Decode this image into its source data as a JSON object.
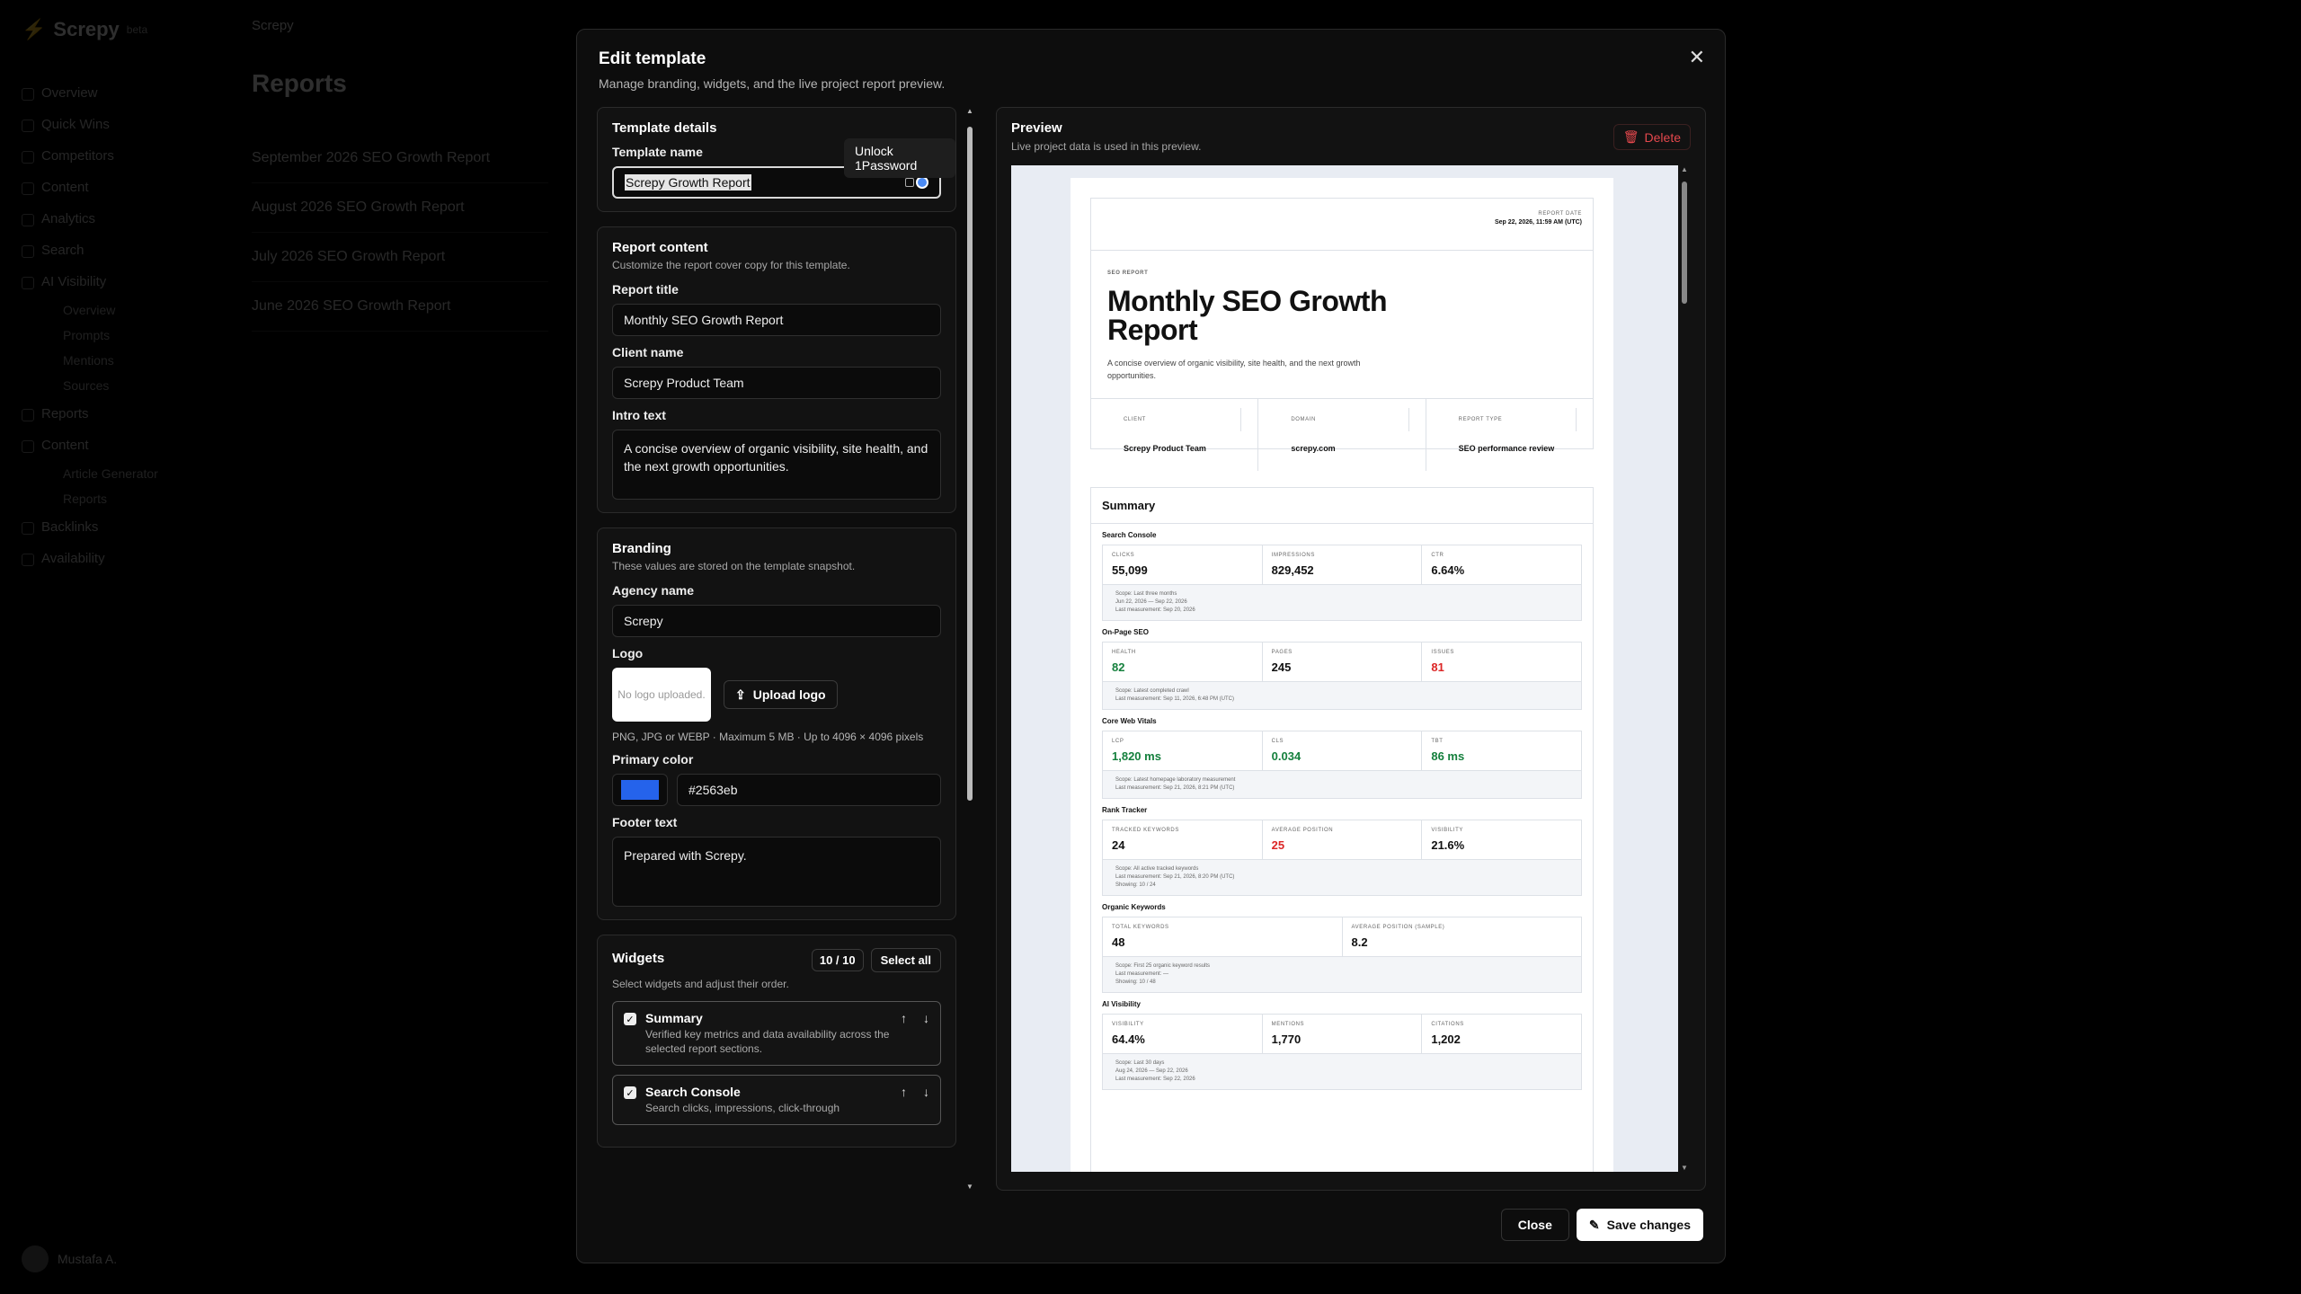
{
  "background": {
    "brand": "Screpy",
    "brand_badge": "beta",
    "workspace": "Screpy",
    "nav": [
      "Overview",
      "Quick Wins",
      "Competitors",
      "Content",
      "Analytics",
      "Search",
      "AI Visibility"
    ],
    "nav_sub": [
      "Overview",
      "Prompts",
      "Mentions",
      "Sources"
    ],
    "nav2": [
      "Reports",
      "Content"
    ],
    "nav2_sub": [
      "Article Generator",
      "Reports"
    ],
    "nav3": [
      "Backlinks",
      "Availability"
    ],
    "page_title": "Reports",
    "rows": [
      "September 2026 SEO Growth Report",
      "August 2026 SEO Growth Report",
      "July 2026 SEO Growth Report",
      "June 2026 SEO Growth Report"
    ],
    "user": "Mustafa A."
  },
  "modal": {
    "title": "Edit template",
    "subtitle": "Manage branding, widgets, and the live project report preview.",
    "template_details": {
      "title": "Template details",
      "name_label": "Template name",
      "name_value": "Screpy Growth Report",
      "tooltip": "Unlock 1Password"
    },
    "report_content": {
      "title": "Report content",
      "desc": "Customize the report cover copy for this template.",
      "report_title_label": "Report title",
      "report_title_value": "Monthly SEO Growth Report",
      "client_label": "Client name",
      "client_value": "Screpy Product Team",
      "intro_label": "Intro text",
      "intro_value": "A concise overview of organic visibility, site health, and the next growth opportunities."
    },
    "branding": {
      "title": "Branding",
      "desc": "These values are stored on the template snapshot.",
      "agency_label": "Agency name",
      "agency_value": "Screpy",
      "logo_label": "Logo",
      "logo_placeholder": "No logo uploaded.",
      "upload_label": "Upload logo",
      "logo_hint": "PNG, JPG or WEBP · Maximum 5 MB · Up to 4096 × 4096 pixels",
      "color_label": "Primary color",
      "color_value": "#2563eb",
      "footer_label": "Footer text",
      "footer_value": "Prepared with Screpy."
    },
    "widgets": {
      "title": "Widgets",
      "count": "10 / 10",
      "select_all": "Select all",
      "desc": "Select widgets and adjust their order.",
      "items": [
        {
          "name": "Summary",
          "desc": "Verified key metrics and data availability across the selected report sections."
        },
        {
          "name": "Search Console",
          "desc": "Search clicks, impressions, click-through"
        }
      ]
    },
    "preview": {
      "title": "Preview",
      "subtitle": "Live project data is used in this preview.",
      "delete_label": "Delete"
    },
    "close_label": "Close",
    "save_label": "Save changes"
  },
  "report": {
    "date_label": "REPORT DATE",
    "date_value": "Sep 22, 2026, 11:59 AM (UTC)",
    "eyebrow": "SEO REPORT",
    "title_line1": "Monthly SEO Growth",
    "title_line2": "Report",
    "intro_line1": "A concise overview of organic visibility, site health, and the next growth",
    "intro_line2": "opportunities.",
    "meta": [
      {
        "label": "CLIENT",
        "value": "Screpy Product Team"
      },
      {
        "label": "DOMAIN",
        "value": "screpy.com"
      },
      {
        "label": "REPORT TYPE",
        "value": "SEO performance review"
      }
    ],
    "summary_title": "Summary",
    "sections": [
      {
        "name": "Search Console",
        "metrics": [
          {
            "label": "CLICKS",
            "value": "55,099"
          },
          {
            "label": "IMPRESSIONS",
            "value": "829,452"
          },
          {
            "label": "CTR",
            "value": "6.64%"
          }
        ],
        "scope": [
          "Scope: Last three months",
          "Jun 22, 2026 — Sep 22, 2026",
          "Last measurement: Sep 20, 2026"
        ]
      },
      {
        "name": "On-Page SEO",
        "metrics": [
          {
            "label": "HEALTH",
            "value": "82"
          },
          {
            "label": "PAGES",
            "value": "245"
          },
          {
            "label": "ISSUES",
            "value": "81"
          }
        ],
        "scope": [
          "Scope: Latest completed crawl",
          "Last measurement: Sep 11, 2026, 6:48 PM (UTC)"
        ]
      },
      {
        "name": "Core Web Vitals",
        "metrics": [
          {
            "label": "LCP",
            "value": "1,820 ms"
          },
          {
            "label": "CLS",
            "value": "0.034"
          },
          {
            "label": "TBT",
            "value": "86 ms"
          }
        ],
        "scope": [
          "Scope: Latest homepage laboratory measurement",
          "Last measurement: Sep 21, 2026, 8:21 PM (UTC)"
        ]
      },
      {
        "name": "Rank Tracker",
        "metrics": [
          {
            "label": "TRACKED KEYWORDS",
            "value": "24"
          },
          {
            "label": "AVERAGE POSITION",
            "value": "25"
          },
          {
            "label": "VISIBILITY",
            "value": "21.6%"
          }
        ],
        "scope": [
          "Scope: All active tracked keywords",
          "Last measurement: Sep 21, 2026, 8:20 PM (UTC)",
          "Showing: 10 / 24"
        ]
      },
      {
        "name": "Organic Keywords",
        "metrics": [
          {
            "label": "TOTAL KEYWORDS",
            "value": "48"
          },
          {
            "label": "AVERAGE POSITION (SAMPLE)",
            "value": "8.2"
          }
        ],
        "scope": [
          "Scope: First 25 organic keyword results",
          "Last measurement: —",
          "Showing: 10 / 48"
        ]
      },
      {
        "name": "AI Visibility",
        "metrics": [
          {
            "label": "VISIBILITY",
            "value": "64.4%"
          },
          {
            "label": "MENTIONS",
            "value": "1,770"
          },
          {
            "label": "CITATIONS",
            "value": "1,202"
          }
        ],
        "scope": [
          "Scope: Last 30 days",
          "Aug 24, 2026 — Sep 22, 2026",
          "Last measurement: Sep 22, 2026"
        ]
      }
    ],
    "colors": {
      "good": "#15803d",
      "bad": "#dc2626",
      "primary": "#2563eb"
    }
  }
}
